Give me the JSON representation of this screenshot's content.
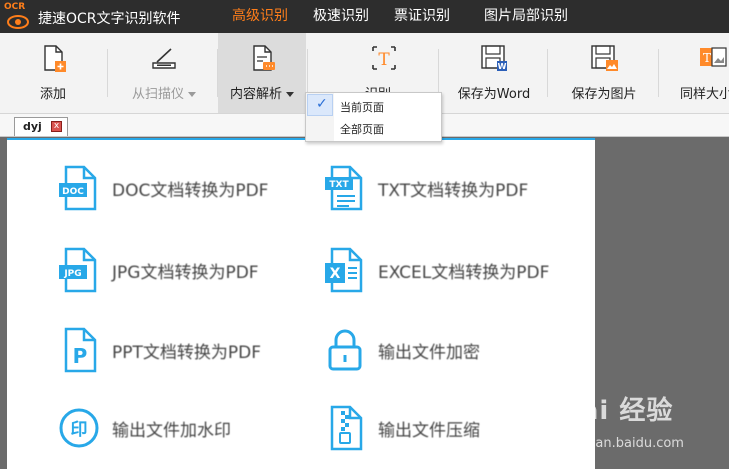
{
  "app": {
    "logo_text": "OCR",
    "title": "捷速OCR文字识别软件"
  },
  "menu": {
    "tabs": [
      {
        "label": "高级识别",
        "active": true
      },
      {
        "label": "极速识别",
        "active": false
      },
      {
        "label": "票证识别",
        "active": false
      },
      {
        "label": "图片局部识别",
        "active": false
      }
    ]
  },
  "toolbar": {
    "add": "添加",
    "scanner": "从扫描仪",
    "content_parse": "内容解析",
    "recognize": "识别",
    "save_word": "保存为Word",
    "save_image": "保存为图片",
    "same_size": "同样大小"
  },
  "dropdown": {
    "items": [
      {
        "label": "当前页面",
        "checked": true
      },
      {
        "label": "全部页面",
        "checked": false
      }
    ]
  },
  "doc_tab": {
    "label": "dyj",
    "close": "x"
  },
  "features": [
    {
      "label": "DOC文档转换为PDF",
      "icon": "doc-file-icon",
      "badge": "DOC"
    },
    {
      "label": "TXT文档转换为PDF",
      "icon": "txt-file-icon",
      "badge": "TXT"
    },
    {
      "label": "JPG文档转换为PDF",
      "icon": "jpg-file-icon",
      "badge": "JPG"
    },
    {
      "label": "EXCEL文档转换为PDF",
      "icon": "excel-file-icon",
      "badge": "X"
    },
    {
      "label": "PPT文档转换为PDF",
      "icon": "ppt-file-icon",
      "badge": "P"
    },
    {
      "label": "输出文件加密",
      "icon": "lock-icon",
      "badge": ""
    },
    {
      "label": "输出文件加水印",
      "icon": "watermark-stamp-icon",
      "badge": "印"
    },
    {
      "label": "输出文件压缩",
      "icon": "zip-file-icon",
      "badge": ""
    }
  ],
  "watermark": {
    "main": "Bai 经验",
    "sub": "jingyan.baidu.com"
  },
  "colors": {
    "accent_orange": "#ff7e1a",
    "icon_blue": "#28a8e8",
    "titlebar_bg": "#2d2d2d"
  }
}
